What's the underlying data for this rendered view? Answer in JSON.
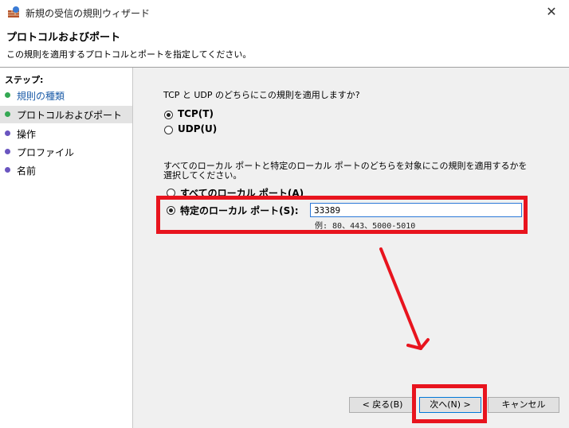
{
  "window": {
    "title": "新規の受信の規則ウィザード",
    "close_glyph": "✕"
  },
  "header": {
    "title": "プロトコルおよびポート",
    "description": "この規則を適用するプロトコルとポートを指定してください。"
  },
  "sidebar": {
    "heading": "ステップ:",
    "items": [
      {
        "label": "規則の種類",
        "status": "done",
        "color": "#34a853"
      },
      {
        "label": "プロトコルおよびポート",
        "status": "current",
        "color": "#34a853"
      },
      {
        "label": "操作",
        "status": "pending",
        "color": "#6a55c0"
      },
      {
        "label": "プロファイル",
        "status": "pending",
        "color": "#6a55c0"
      },
      {
        "label": "名前",
        "status": "pending",
        "color": "#6a55c0"
      }
    ]
  },
  "protocol": {
    "question": "TCP と UDP のどちらにこの規則を適用しますか?",
    "options": [
      {
        "label": "TCP(T)",
        "selected": true
      },
      {
        "label": "UDP(U)",
        "selected": false
      }
    ]
  },
  "ports": {
    "question": "すべてのローカル ポートと特定のローカル ポートのどちらを対象にこの規則を適用するかを選択してください。",
    "options": [
      {
        "label": "すべてのローカル ポート(A)",
        "selected": false
      },
      {
        "label": "特定のローカル ポート(S):",
        "selected": true
      }
    ],
    "input_value": "33389",
    "example": "例: 80、443、5000-5010"
  },
  "buttons": {
    "back": "< 戻る(B)",
    "next": "次へ(N) >",
    "cancel": "キャンセル"
  },
  "annotation": {
    "color": "#e8141e"
  }
}
